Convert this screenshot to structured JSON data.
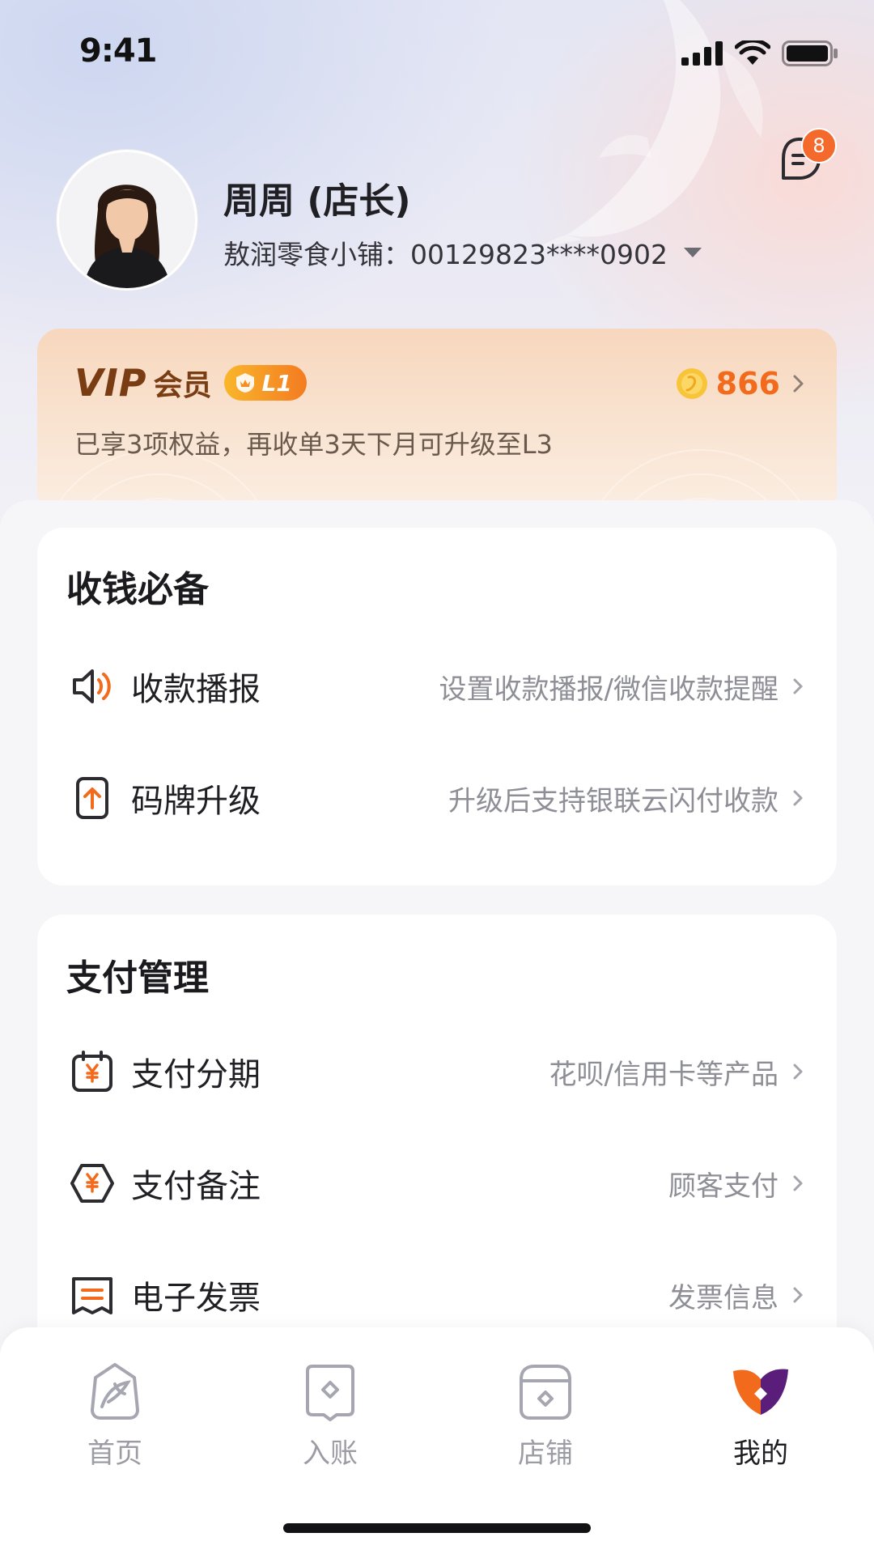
{
  "status_bar": {
    "time": "9:41"
  },
  "profile": {
    "name": "周周 (店长)",
    "store": "敖润零食小铺：00129823****0902",
    "message_badge": "8"
  },
  "vip": {
    "vip_text": "VIP",
    "member_text": "会员",
    "level": "L1",
    "subtitle": "已享3项权益，再收单3天下月可升级至L3",
    "coins": "866"
  },
  "sections": [
    {
      "title": "收钱必备",
      "items": [
        {
          "label": "收款播报",
          "desc": "设置收款播报/微信收款提醒",
          "icon": "speaker-icon"
        },
        {
          "label": "码牌升级",
          "desc": "升级后支持银联云闪付收款",
          "icon": "upgrade-icon"
        }
      ]
    },
    {
      "title": "支付管理",
      "items": [
        {
          "label": "支付分期",
          "desc": "花呗/信用卡等产品",
          "icon": "calendar-yuan-icon"
        },
        {
          "label": "支付备注",
          "desc": "顾客支付",
          "icon": "hexagon-yuan-icon"
        },
        {
          "label": "电子发票",
          "desc": "发票信息",
          "icon": "invoice-icon"
        }
      ]
    }
  ],
  "tabbar": {
    "tabs": [
      {
        "label": "首页",
        "icon": "koi-home-icon"
      },
      {
        "label": "入账",
        "icon": "income-icon"
      },
      {
        "label": "店铺",
        "icon": "store-icon"
      },
      {
        "label": "我的",
        "icon": "mine-logo-icon",
        "active": true
      }
    ]
  },
  "colors": {
    "accent": "#f26a1b",
    "vip_brown": "#7a3c12",
    "badge": "#f36a2c"
  }
}
